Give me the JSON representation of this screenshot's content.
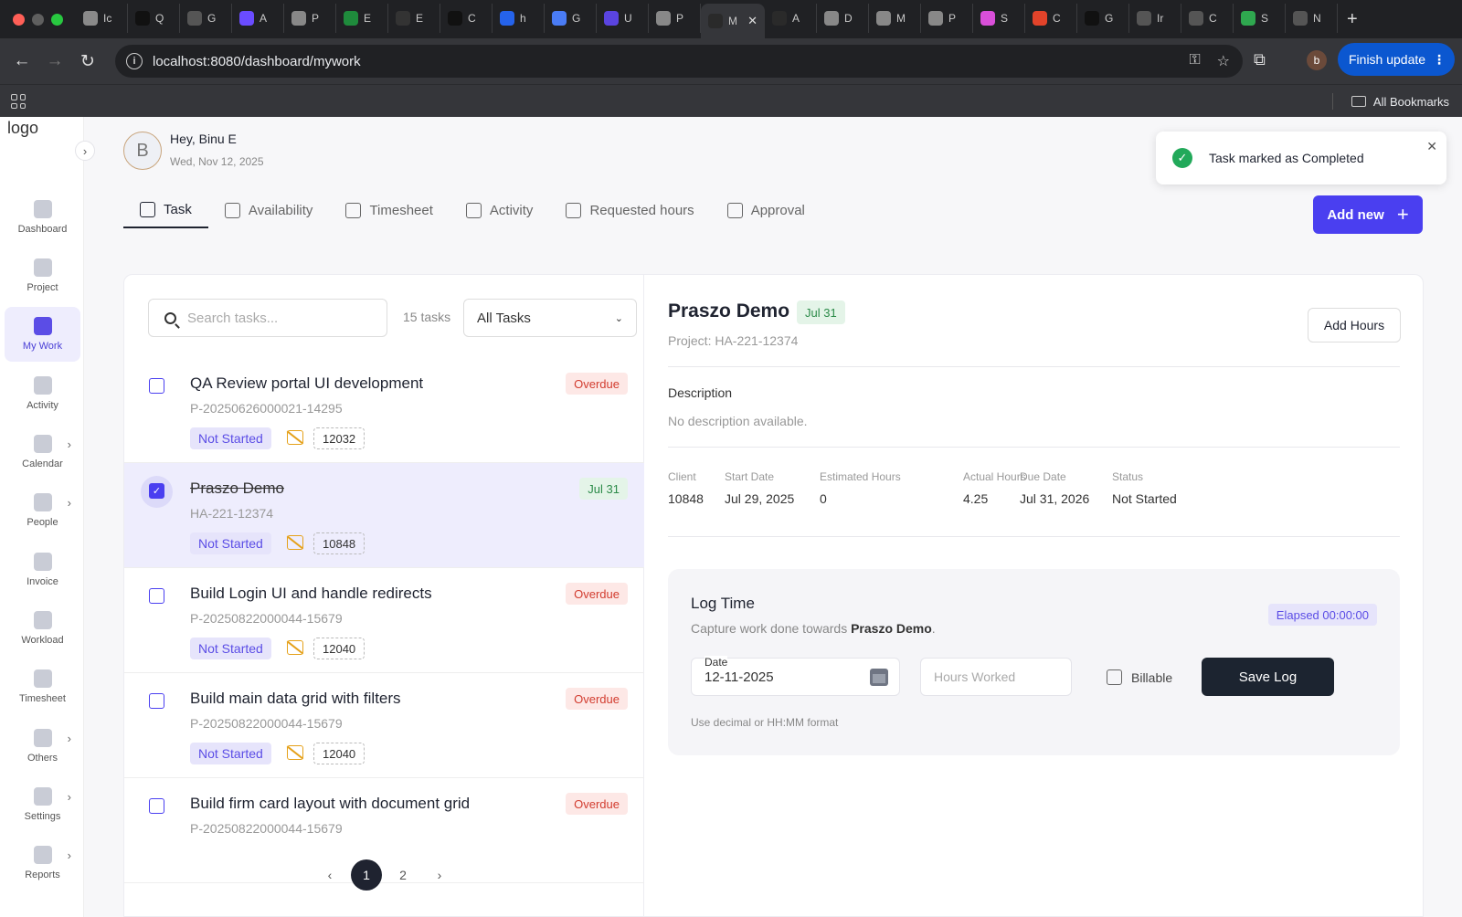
{
  "browser": {
    "tabs": [
      {
        "letter": "Ic",
        "color": "#8a8a8a"
      },
      {
        "letter": "Q",
        "color": "#111"
      },
      {
        "letter": "G",
        "color": "#555"
      },
      {
        "letter": "A",
        "color": "#6a4cff"
      },
      {
        "letter": "P",
        "color": "#888"
      },
      {
        "letter": "E",
        "color": "#1f8b3c"
      },
      {
        "letter": "E",
        "color": "#333"
      },
      {
        "letter": "C",
        "color": "#111"
      },
      {
        "letter": "h",
        "color": "#2563eb"
      },
      {
        "letter": "G",
        "color": "#4a7cf5"
      },
      {
        "letter": "U",
        "color": "#5a44e0"
      },
      {
        "letter": "P",
        "color": "#888"
      },
      {
        "letter": "M",
        "color": "#2a2a2a",
        "active": true
      },
      {
        "letter": "A",
        "color": "#2a2a2a"
      },
      {
        "letter": "D",
        "color": "#888"
      },
      {
        "letter": "M",
        "color": "#888"
      },
      {
        "letter": "P",
        "color": "#888"
      },
      {
        "letter": "S",
        "color": "#d94fd9"
      },
      {
        "letter": "C",
        "color": "#e2432a"
      },
      {
        "letter": "G",
        "color": "#111"
      },
      {
        "letter": "Ir",
        "color": "#555"
      },
      {
        "letter": "C",
        "color": "#555"
      },
      {
        "letter": "S",
        "color": "#2fa84f"
      },
      {
        "letter": "N",
        "color": "#555"
      }
    ],
    "url": "localhost:8080/dashboard/mywork",
    "update_button": "Finish update",
    "profile_initial": "b",
    "all_bookmarks": "All Bookmarks"
  },
  "sidebar": {
    "logo_alt": "logo",
    "items": [
      {
        "label": "Dashboard",
        "icon": "dashboard-icon"
      },
      {
        "label": "Project",
        "icon": "project-icon"
      },
      {
        "label": "My Work",
        "icon": "my-work-icon",
        "active": true
      },
      {
        "label": "Activity",
        "icon": "activity-icon"
      },
      {
        "label": "Calendar",
        "icon": "calendar-icon",
        "chevron": true
      },
      {
        "label": "People",
        "icon": "people-icon",
        "chevron": true
      },
      {
        "label": "Invoice",
        "icon": "invoice-icon"
      },
      {
        "label": "Workload",
        "icon": "workload-icon"
      },
      {
        "label": "Timesheet",
        "icon": "timesheet-icon"
      },
      {
        "label": "Others",
        "icon": "others-icon",
        "chevron": true
      },
      {
        "label": "Settings",
        "icon": "settings-icon",
        "chevron": true
      },
      {
        "label": "Reports",
        "icon": "reports-icon",
        "chevron": true
      }
    ]
  },
  "header": {
    "avatar_initial": "B",
    "greeting": "Hey, Binu E",
    "date": "Wed, Nov 12, 2025"
  },
  "tabs": [
    {
      "label": "Task",
      "active": true
    },
    {
      "label": "Availability"
    },
    {
      "label": "Timesheet"
    },
    {
      "label": "Activity"
    },
    {
      "label": "Requested hours"
    },
    {
      "label": "Approval"
    }
  ],
  "add_new": "Add new",
  "toast": {
    "message": "Task marked as Completed"
  },
  "task_list": {
    "search_placeholder": "Search tasks...",
    "count": "15 tasks",
    "filter": "All Tasks",
    "tasks": [
      {
        "title": "QA Review portal UI development",
        "code": "P-20250626000021-14295",
        "status": "Not Started",
        "number": "12032",
        "badge": "Overdue",
        "badge_type": "over"
      },
      {
        "title": "Praszo Demo",
        "code": "HA-221-12374",
        "status": "Not Started",
        "number": "10848",
        "badge": "Jul 31",
        "badge_type": "due",
        "selected": true,
        "checked": true
      },
      {
        "title": "Build Login UI and handle redirects",
        "code": "P-20250822000044-15679",
        "status": "Not Started",
        "number": "12040",
        "badge": "Overdue",
        "badge_type": "over"
      },
      {
        "title": "Build main data grid with filters",
        "code": "P-20250822000044-15679",
        "status": "Not Started",
        "number": "12040",
        "badge": "Overdue",
        "badge_type": "over"
      },
      {
        "title": "Build firm card layout with document grid",
        "code": "P-20250822000044-15679",
        "status": "",
        "number": "",
        "badge": "Overdue",
        "badge_type": "over"
      }
    ],
    "pagination": {
      "prev": "‹",
      "pages": [
        "1",
        "2"
      ],
      "current": "1",
      "next": "›"
    }
  },
  "detail": {
    "title": "Praszo Demo",
    "due_badge": "Jul 31",
    "project": "Project: HA-221-12374",
    "add_hours": "Add Hours",
    "description_heading": "Description",
    "description": "No description available.",
    "meta": [
      {
        "key": "Client",
        "value": "10848"
      },
      {
        "key": "Start Date",
        "value": "Jul 29, 2025"
      },
      {
        "key": "Estimated Hours",
        "value": "0"
      },
      {
        "key": "Actual Hours",
        "value": "4.25"
      },
      {
        "key": "Due Date",
        "value": "Jul 31, 2026"
      },
      {
        "key": "Status",
        "value": "Not Started"
      }
    ],
    "log_time": {
      "title": "Log Time",
      "subtitle_prefix": "Capture work done towards ",
      "subtitle_task": "Praszo Demo",
      "subtitle_suffix": ".",
      "elapsed": "Elapsed 00:00:00",
      "date_label": "Date",
      "date_value": "12-11-2025",
      "hours_placeholder": "Hours Worked",
      "billable_label": "Billable",
      "save_label": "Save Log",
      "hint": "Use decimal or HH:MM format"
    }
  },
  "colors": {
    "accent": "#4a3ff0",
    "overdue": "#d23c2f",
    "due": "#2b8a48",
    "dark_button": "#1c2430"
  }
}
